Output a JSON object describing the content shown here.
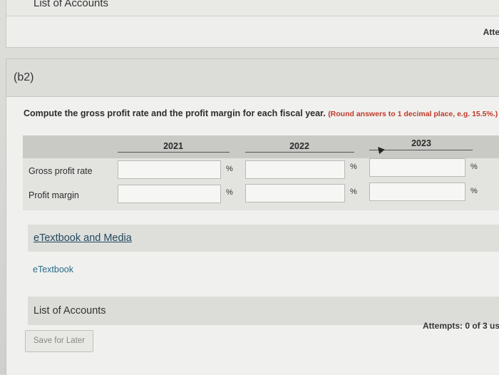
{
  "top_section": {
    "list_of_accounts": "List of Accounts",
    "attempts_truncated": "Atte"
  },
  "question_part": {
    "label": "(b2)",
    "prompt": "Compute the gross profit rate and the profit margin for each fiscal year.",
    "hint": "(Round answers to 1 decimal place, e.g. 15.5%.)"
  },
  "table": {
    "columns": [
      "2021",
      "2022",
      "2023"
    ],
    "rows": [
      {
        "label": "Gross profit rate",
        "values": [
          "",
          "",
          ""
        ],
        "unit": "%"
      },
      {
        "label": "Profit margin",
        "values": [
          "",
          "",
          ""
        ],
        "unit": "%"
      }
    ]
  },
  "resources": {
    "etextbook_media": "eTextbook and Media",
    "etextbook": "eTextbook",
    "list_of_accounts": "List of Accounts"
  },
  "footer": {
    "attempts": "Attempts: 0 of 3 us",
    "save_later": "Save for Later"
  }
}
